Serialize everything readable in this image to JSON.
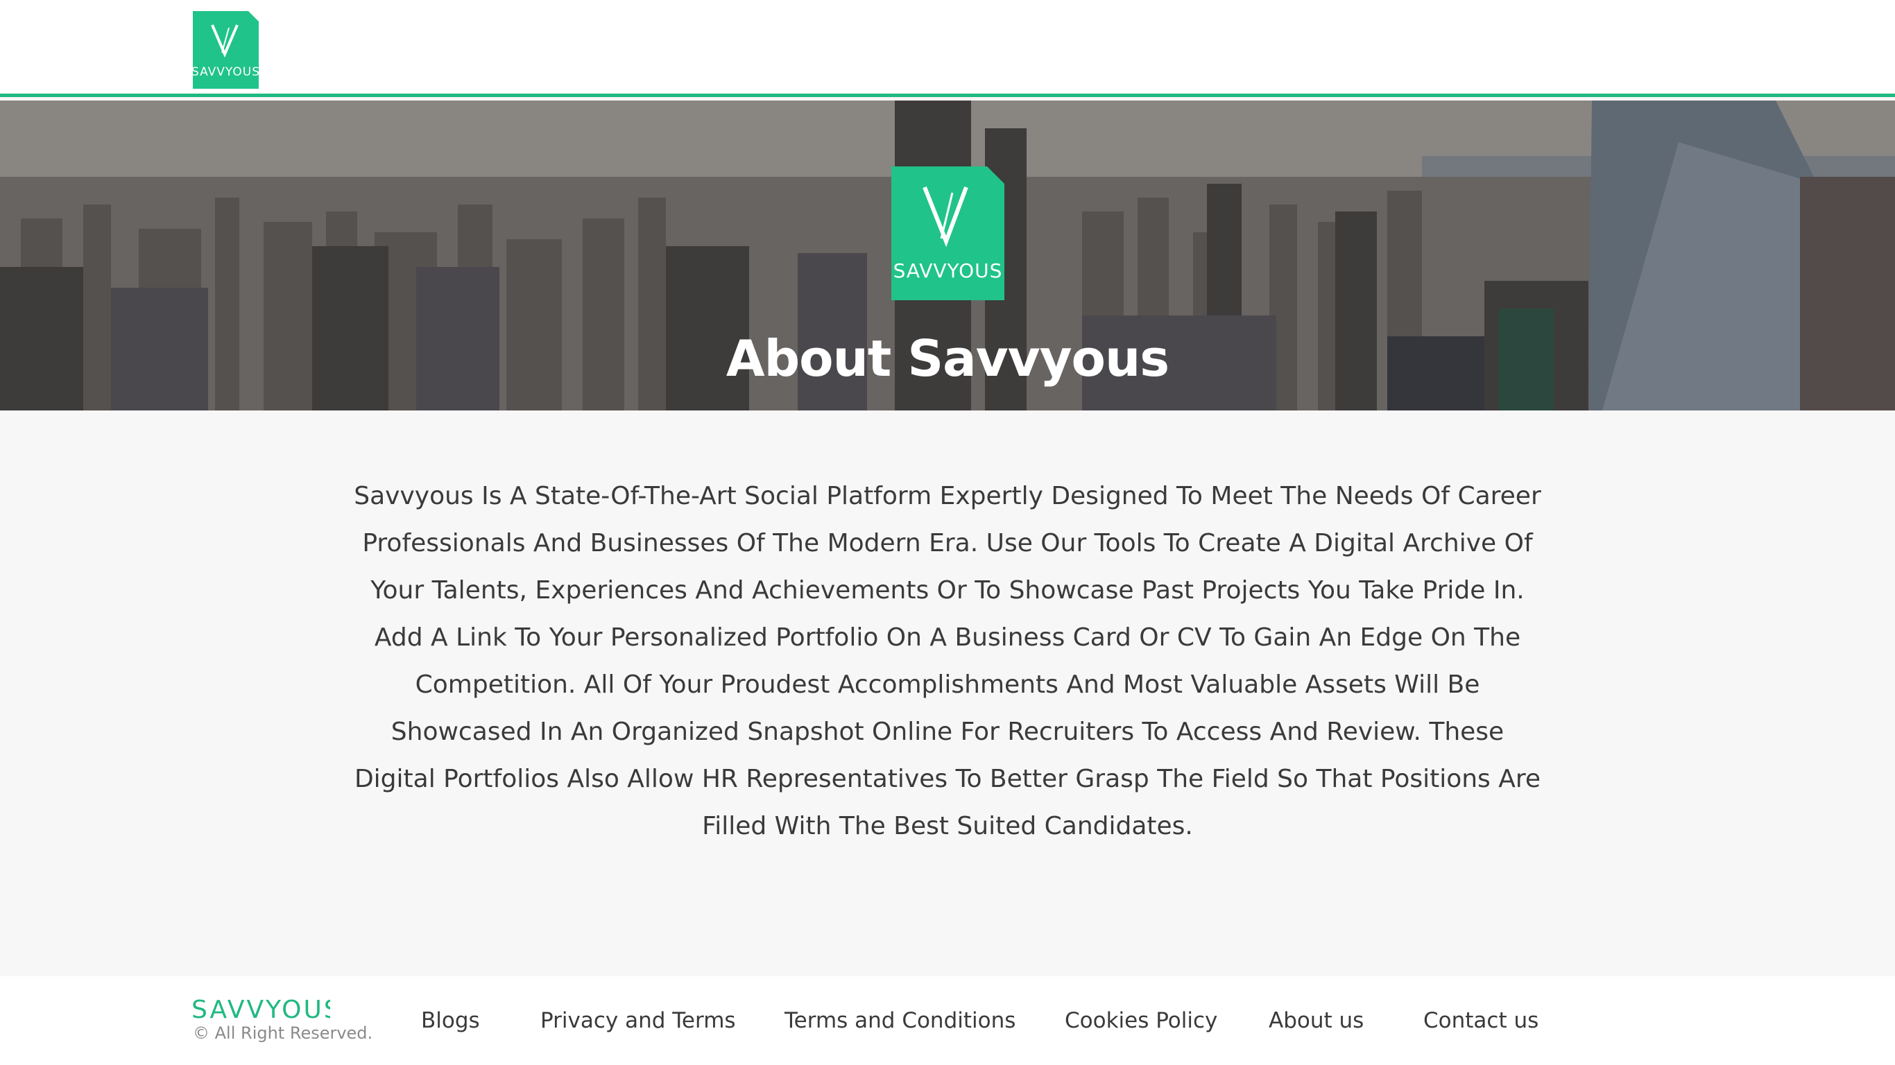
{
  "brand": {
    "name": "SAVVYOUS",
    "mark": "V",
    "accent_color": "#20b981"
  },
  "hero": {
    "title": "About Savvyous",
    "background": "city-skyline-photo"
  },
  "about": {
    "text": "Savvyous Is A State-Of-The-Art Social Platform Expertly Designed To Meet The Needs Of Career Professionals And Businesses Of The Modern Era. Use Our Tools To Create A Digital Archive Of Your Talents, Experiences And Achievements Or To Showcase Past Projects You Take Pride In. Add A Link To Your Personalized Portfolio On A Business Card Or CV To Gain An Edge On The Competition. All Of Your Proudest Accomplishments And Most Valuable Assets Will Be Showcased In An Organized Snapshot Online For Recruiters To Access And Review. These Digital Portfolios Also Allow HR Representatives To Better Grasp The Field So That Positions Are Filled With The Best Suited Candidates."
  },
  "footer": {
    "brand": "SAVVYOUS",
    "copyright": "© All Right Reserved.",
    "links": [
      "Blogs",
      "Privacy and Terms",
      "Terms and Conditions",
      "Cookies Policy",
      "About us",
      "Contact us"
    ]
  }
}
